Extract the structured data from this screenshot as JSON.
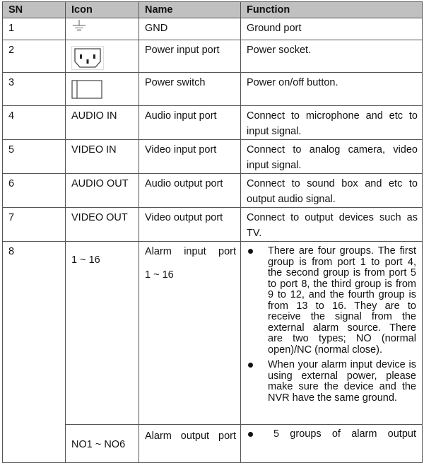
{
  "table": {
    "headers": [
      "SN",
      "Icon",
      "Name",
      "Function"
    ],
    "header_bg": "#c0c0c0",
    "rows": [
      {
        "sn": "1",
        "icon": "ground-symbol",
        "icon_text": "",
        "name": "GND",
        "function": "Ground port"
      },
      {
        "sn": "2",
        "icon": "power-socket",
        "icon_text": "",
        "name": "Power input port",
        "function": "Power socket."
      },
      {
        "sn": "3",
        "icon": "power-switch",
        "icon_text": "",
        "name": "Power switch",
        "function": "Power on/off button."
      },
      {
        "sn": "4",
        "icon": "",
        "icon_text": "AUDIO IN",
        "name": "Audio input port",
        "function": "Connect to microphone and etc to input signal."
      },
      {
        "sn": "5",
        "icon": "",
        "icon_text": "VIDEO IN",
        "name": "Video input port",
        "function": "Connect to analog camera, video input signal."
      },
      {
        "sn": "6",
        "icon": "",
        "icon_text": "AUDIO OUT",
        "name": "Audio output port",
        "function": "Connect to sound box and etc to output audio signal."
      },
      {
        "sn": "7",
        "icon": "",
        "icon_text": "VIDEO OUT",
        "name": "Video output port",
        "function": "Connect to output devices such as TV."
      },
      {
        "sn": "8",
        "icon_text": "1 ~ 16",
        "name": "Alarm input port",
        "name_sub": "1 ~ 16",
        "function_bullets": [
          "There are four groups. The first group is from port 1 to port 4, the second group is from port 5 to port 8, the third group is from 9 to 12, and the fourth group is from 13 to 16. They are to receive the signal from the external alarm source. There are two types; NO (normal open)/NC (normal close).",
          "When your alarm input device is using external power, please make sure the device and the NVR have the same ground."
        ]
      },
      {
        "sn": "",
        "icon_text": "NO1 ~ NO6",
        "name": "Alarm output port",
        "function_bullets": [
          "5 groups of alarm output"
        ]
      }
    ]
  }
}
